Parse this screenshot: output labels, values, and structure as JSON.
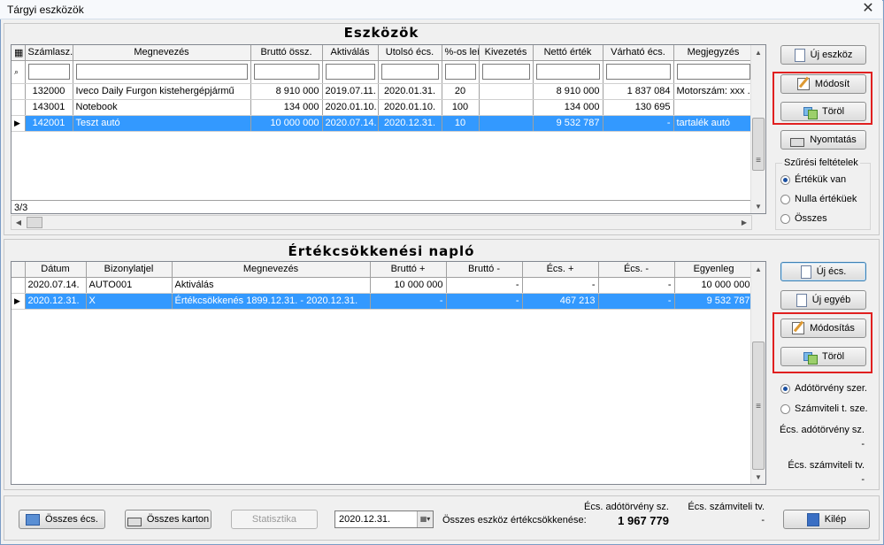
{
  "window": {
    "title": "Tárgyi eszközök",
    "close": "✕"
  },
  "assets": {
    "title": "Eszközök",
    "columns": [
      "Számlasz.",
      "Megnevezés",
      "Bruttó össz.",
      "Aktiválás",
      "Utolsó écs.",
      "%-os leír.",
      "Kivezetés",
      "Nettó érték",
      "Várható écs.",
      "Megjegyzés"
    ],
    "rows": [
      [
        "132000",
        "Iveco Daily Furgon kistehergépjármű",
        "8 910 000",
        "2019.07.11.",
        "2020.01.31.",
        "20",
        "",
        "8 910 000",
        "1 837 084",
        "Motorszám: xxx  ."
      ],
      [
        "143001",
        "Notebook",
        "134 000",
        "2020.01.10.",
        "2020.01.10.",
        "100",
        "",
        "134 000",
        "130 695",
        ""
      ],
      [
        "142001",
        "Teszt autó",
        "10 000 000",
        "2020.07.14.",
        "2020.12.31.",
        "10",
        "",
        "9 532 787",
        "-",
        "tartalék autó"
      ]
    ],
    "selected_row": 2,
    "count": "3/3"
  },
  "asset_buttons": {
    "new": "Új eszköz",
    "edit": "Módosít",
    "delete": "Töröl",
    "print": "Nyomtatás"
  },
  "filter": {
    "title": "Szűrési feltételek",
    "options": [
      "Értékük van",
      "Nulla értéküek",
      "Összes"
    ],
    "selected": 0
  },
  "log": {
    "title": "Értékcsökkenési napló",
    "columns": [
      "Dátum",
      "Bizonylatjel",
      "Megnevezés",
      "Bruttó +",
      "Bruttó -",
      "Écs. +",
      "Écs. -",
      "Egyenleg"
    ],
    "rows": [
      [
        "2020.07.14.",
        "AUTO001",
        "Aktiválás",
        "10 000 000",
        "-",
        "-",
        "-",
        "10 000 000"
      ],
      [
        "2020.12.31.",
        "X",
        "Értékcsökkenés 1899.12.31. - 2020.12.31.",
        "-",
        "-",
        "467 213",
        "-",
        "9 532 787"
      ]
    ],
    "selected_row": 1
  },
  "log_buttons": {
    "new_ecs": "Új écs.",
    "new_other": "Új egyéb",
    "edit": "Módosítás",
    "delete": "Töröl"
  },
  "log_mode": {
    "options": [
      "Adótörvény szer.",
      "Számviteli t. sze."
    ],
    "selected": 0
  },
  "log_summary": {
    "tax_label": "Écs. adótörvény sz.",
    "tax_value": "-",
    "acct_label": "Écs. számviteli tv.",
    "acct_value": "-"
  },
  "footer": {
    "all_ecs": "Összes écs.",
    "all_card": "Összes karton",
    "stats": "Statisztika",
    "date": "2020.12.31.",
    "total_label": "Összes eszköz értékcsökkenése:",
    "tax_head": "Écs. adótörvény sz.",
    "tax_total": "1 967 779",
    "acct_head": "Écs. számviteli tv.",
    "acct_total": "-",
    "exit": "Kilép"
  },
  "colors": {
    "selection": "#3399ff",
    "highlight_box": "#e02020"
  }
}
